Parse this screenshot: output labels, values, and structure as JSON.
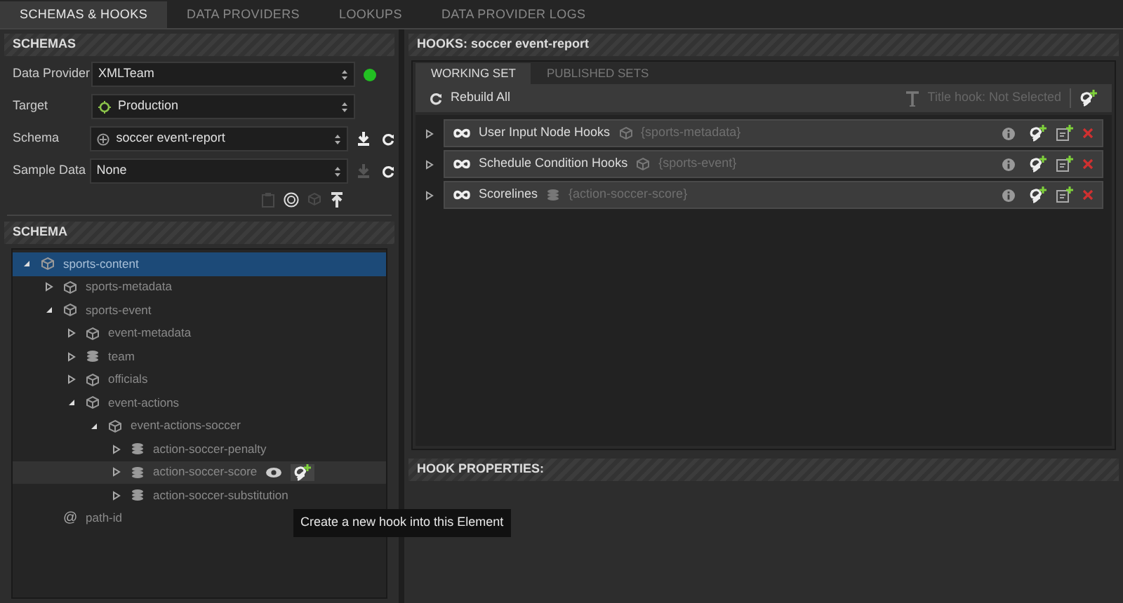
{
  "top_tabs": [
    {
      "label": "SCHEMAS & HOOKS",
      "selected": true
    },
    {
      "label": "DATA PROVIDERS",
      "selected": false
    },
    {
      "label": "LOOKUPS",
      "selected": false
    },
    {
      "label": "DATA PROVIDER LOGS",
      "selected": false
    }
  ],
  "schemas": {
    "title": "SCHEMAS",
    "fields": [
      {
        "label": "Data Provider",
        "value": "XMLTeam",
        "kind": "plain",
        "connected": true
      },
      {
        "label": "Target",
        "value": "Production",
        "kind": "target"
      },
      {
        "label": "Schema",
        "value": "soccer event-report",
        "kind": "schema",
        "actions": [
          {
            "kind": "download",
            "disabled": false
          },
          {
            "kind": "refresh",
            "disabled": false
          }
        ]
      },
      {
        "label": "Sample Data",
        "value": "None",
        "kind": "plain",
        "actions": [
          {
            "kind": "download",
            "disabled": true
          },
          {
            "kind": "refresh",
            "disabled": false
          }
        ]
      }
    ],
    "tools": [
      {
        "kind": "clipboard",
        "disabled": true
      },
      {
        "kind": "schema",
        "disabled": false
      },
      {
        "kind": "cube",
        "disabled": true
      },
      {
        "kind": "upload",
        "disabled": false
      }
    ]
  },
  "schema_tree": {
    "title": "SCHEMA",
    "items": [
      {
        "label": "sports-content",
        "kind": "object",
        "expanded": true,
        "selected": true,
        "hovered": false,
        "children": [
          {
            "label": "sports-metadata",
            "kind": "object",
            "expanded": false,
            "selected": false,
            "hovered": false
          },
          {
            "label": "sports-event",
            "kind": "object",
            "expanded": true,
            "selected": false,
            "hovered": false,
            "children": [
              {
                "label": "event-metadata",
                "kind": "object",
                "expanded": false,
                "selected": false,
                "hovered": false
              },
              {
                "label": "team",
                "kind": "array",
                "expanded": false,
                "selected": false,
                "hovered": false
              },
              {
                "label": "officials",
                "kind": "object",
                "expanded": false,
                "selected": false,
                "hovered": false
              },
              {
                "label": "event-actions",
                "kind": "object",
                "expanded": true,
                "selected": false,
                "hovered": false,
                "children": [
                  {
                    "label": "event-actions-soccer",
                    "kind": "object",
                    "expanded": true,
                    "selected": false,
                    "hovered": false,
                    "children": [
                      {
                        "label": "action-soccer-penalty",
                        "kind": "array",
                        "expanded": false,
                        "selected": false,
                        "hovered": false
                      },
                      {
                        "label": "action-soccer-score",
                        "kind": "array",
                        "expanded": false,
                        "selected": false,
                        "hovered": true
                      },
                      {
                        "label": "action-soccer-substitution",
                        "kind": "array",
                        "expanded": false,
                        "selected": false,
                        "hovered": false
                      }
                    ]
                  }
                ]
              }
            ]
          },
          {
            "label": "path-id",
            "kind": "attribute",
            "glyph": "@",
            "selected": false,
            "hovered": false
          }
        ]
      }
    ]
  },
  "tooltip": {
    "text": "Create a new hook into this Element"
  },
  "hooks": {
    "title": "HOOKS: soccer event-report",
    "tabs": [
      {
        "label": "WORKING SET",
        "selected": true
      },
      {
        "label": "PUBLISHED SETS",
        "selected": false
      }
    ],
    "rebuild_label": "Rebuild All",
    "title_hook": "Title hook: Not Selected",
    "items": [
      {
        "name": "User Input Node Hooks",
        "kind": "object",
        "element": "{sports-metadata}"
      },
      {
        "name": "Schedule Condition Hooks",
        "kind": "object",
        "element": "{sports-event}"
      },
      {
        "name": "Scorelines",
        "kind": "array",
        "element": "{action-soccer-score}"
      }
    ]
  },
  "hook_properties": {
    "title": "HOOK PROPERTIES:"
  }
}
